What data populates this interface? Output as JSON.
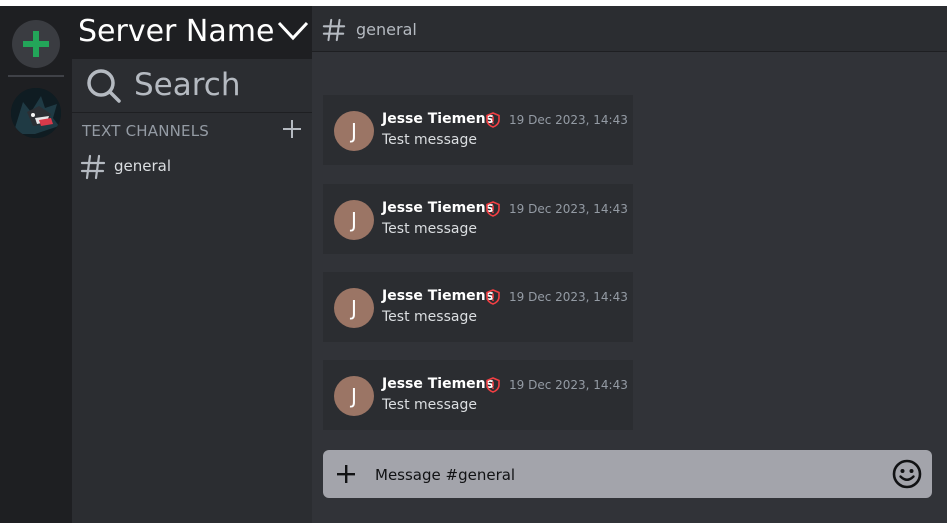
{
  "server_rail": {
    "add_server_icon": "plus-icon",
    "servers": [
      {
        "icon": "server-avatar"
      }
    ]
  },
  "sidebar": {
    "server_name": "Server Name",
    "search_placeholder": "Search",
    "section_label": "TEXT CHANNELS",
    "channels": [
      {
        "name": "general"
      }
    ]
  },
  "channel_header": {
    "name": "general"
  },
  "messages": [
    {
      "author": "Jesse Tiemens",
      "avatar_initial": "J",
      "timestamp": "19 Dec 2023, 14:43",
      "text": "Test message"
    },
    {
      "author": "Jesse Tiemens",
      "avatar_initial": "J",
      "timestamp": "19 Dec 2023, 14:43",
      "text": "Test message"
    },
    {
      "author": "Jesse Tiemens",
      "avatar_initial": "J",
      "timestamp": "19 Dec 2023, 14:43",
      "text": "Test message"
    },
    {
      "author": "Jesse Tiemens",
      "avatar_initial": "J",
      "timestamp": "19 Dec 2023, 14:43",
      "text": "Test message"
    }
  ],
  "composer": {
    "placeholder": "Message #general"
  },
  "colors": {
    "accent_green": "#23a559",
    "badge_red": "#f23f43",
    "avatar_bg": "#9b7565"
  }
}
